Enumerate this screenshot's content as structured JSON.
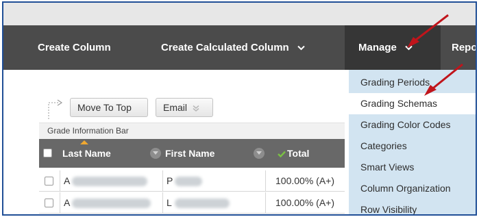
{
  "toolbar": {
    "create_column": "Create Column",
    "create_calculated_column": "Create Calculated Column",
    "manage": "Manage",
    "reports_truncated": "Repo"
  },
  "manage_menu": {
    "items": [
      "Grading Periods",
      "Grading Schemas",
      "Grading Color Codes",
      "Categories",
      "Smart Views",
      "Column Organization",
      "Row Visibility"
    ],
    "highlighted": "Grading Schemas"
  },
  "actions": {
    "move_to_top": "Move To Top",
    "email": "Email"
  },
  "info_bar": "Grade Information Bar",
  "table": {
    "headers": {
      "last_name": "Last Name",
      "first_name": "First Name",
      "total": "Total"
    },
    "rows": [
      {
        "last_initial": "A",
        "first_initial": "P",
        "total": "100.00% (A+)"
      },
      {
        "last_initial": "A",
        "first_initial": "L",
        "total": "100.00% (A+)"
      }
    ]
  },
  "colors": {
    "toolbar_bg": "#4b4b4b",
    "manage_active_bg": "#363636",
    "menu_bg": "#d2e4f1",
    "table_header_bg": "#686868",
    "annotation_arrow": "#c0141b",
    "sort_indicator": "#f0a830",
    "total_check": "#7ac143",
    "frame_border": "#1f4e96"
  },
  "icons": {
    "dropdown": "chevron-down-icon",
    "move_to_top": "arrow-to-top-icon",
    "email_dropdown": "double-chevron-icon",
    "column_menu": "column-menu-icon",
    "total_check": "check-icon",
    "annotation": "red-arrow-annotation"
  }
}
